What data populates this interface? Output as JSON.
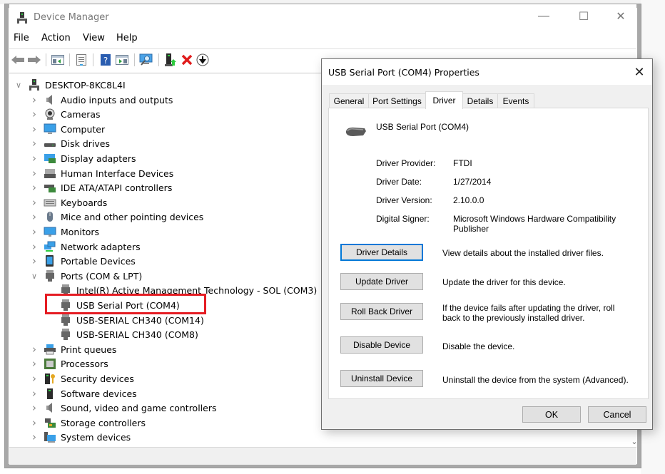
{
  "main_window": {
    "title": "Device Manager",
    "controls": {
      "minimize": "—",
      "maximize": "☐",
      "close": "✕"
    },
    "menu": [
      "File",
      "Action",
      "View",
      "Help"
    ],
    "toolbar": [
      {
        "name": "back-icon",
        "glyph": "⇦"
      },
      {
        "name": "forward-icon",
        "glyph": "⇨"
      },
      {
        "name": "show-hide-console-tree-icon",
        "glyph": ""
      },
      {
        "name": "properties-icon",
        "glyph": ""
      },
      {
        "name": "help-icon",
        "glyph": "?"
      },
      {
        "name": "show-hide-action-pane-icon",
        "glyph": ""
      },
      {
        "name": "scan-hardware-icon",
        "glyph": ""
      },
      {
        "name": "update-driver-icon",
        "glyph": ""
      },
      {
        "name": "uninstall-device-icon",
        "glyph": "✖"
      },
      {
        "name": "disable-device-icon",
        "glyph": "⬇"
      }
    ],
    "tree": {
      "root": "DESKTOP-8KC8L4I",
      "categories": [
        {
          "label": "Audio inputs and outputs",
          "icon": "speaker-icon",
          "expanded": false
        },
        {
          "label": "Cameras",
          "icon": "camera-icon",
          "expanded": false
        },
        {
          "label": "Computer",
          "icon": "computer-icon",
          "expanded": false
        },
        {
          "label": "Disk drives",
          "icon": "disk-drive-icon",
          "expanded": false
        },
        {
          "label": "Display adapters",
          "icon": "display-adapter-icon",
          "expanded": false
        },
        {
          "label": "Human Interface Devices",
          "icon": "hid-icon",
          "expanded": false
        },
        {
          "label": "IDE ATA/ATAPI controllers",
          "icon": "ide-controller-icon",
          "expanded": false
        },
        {
          "label": "Keyboards",
          "icon": "keyboard-icon",
          "expanded": false
        },
        {
          "label": "Mice and other pointing devices",
          "icon": "mouse-icon",
          "expanded": false
        },
        {
          "label": "Monitors",
          "icon": "monitor-icon",
          "expanded": false
        },
        {
          "label": "Network adapters",
          "icon": "network-adapter-icon",
          "expanded": false
        },
        {
          "label": "Portable Devices",
          "icon": "portable-device-icon",
          "expanded": false
        },
        {
          "label": "Ports (COM & LPT)",
          "icon": "port-icon",
          "expanded": true,
          "children": [
            "Intel(R) Active Management Technology - SOL (COM3)",
            "USB Serial Port (COM4)",
            "USB-SERIAL CH340 (COM14)",
            "USB-SERIAL CH340 (COM8)"
          ]
        },
        {
          "label": "Print queues",
          "icon": "printer-icon",
          "expanded": false
        },
        {
          "label": "Processors",
          "icon": "processor-icon",
          "expanded": false
        },
        {
          "label": "Security devices",
          "icon": "security-device-icon",
          "expanded": false
        },
        {
          "label": "Software devices",
          "icon": "software-device-icon",
          "expanded": false
        },
        {
          "label": "Sound, video and game controllers",
          "icon": "speaker-icon",
          "expanded": false
        },
        {
          "label": "Storage controllers",
          "icon": "storage-controller-icon",
          "expanded": false
        },
        {
          "label": "System devices",
          "icon": "system-device-icon",
          "expanded": false
        }
      ],
      "highlighted_item": "USB Serial Port (COM4)",
      "highlight_color": "#e51c23"
    }
  },
  "dialog": {
    "title": "USB Serial Port (COM4) Properties",
    "close": "✕",
    "tabs": [
      "General",
      "Port Settings",
      "Driver",
      "Details",
      "Events"
    ],
    "active_tab": "Driver",
    "device_name": "USB Serial Port (COM4)",
    "properties": [
      {
        "label": "Driver Provider:",
        "value": "FTDI"
      },
      {
        "label": "Driver Date:",
        "value": "1/27/2014"
      },
      {
        "label": "Driver Version:",
        "value": "2.10.0.0"
      },
      {
        "label": "Digital Signer:",
        "value": "Microsoft Windows Hardware Compatibility Publisher"
      }
    ],
    "actions": [
      {
        "label": "Driver Details",
        "description": "View details about the installed driver files."
      },
      {
        "label": "Update Driver",
        "description": "Update the driver for this device."
      },
      {
        "label": "Roll Back Driver",
        "description": "If the device fails after updating the driver, roll back to the previously installed driver."
      },
      {
        "label": "Disable Device",
        "description": "Disable the device."
      },
      {
        "label": "Uninstall Device",
        "description": "Uninstall the device from the system (Advanced)."
      }
    ],
    "ok": "OK",
    "cancel": "Cancel",
    "focus_color": "#0078d7"
  }
}
